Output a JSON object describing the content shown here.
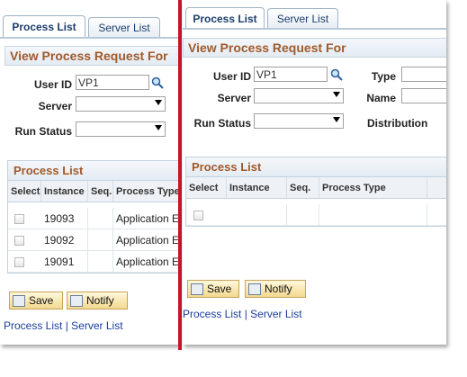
{
  "tabs": [
    {
      "label": "Process List",
      "underline": "P",
      "rest": "rocess List"
    },
    {
      "label": "Server List",
      "underline": "S",
      "rest": "erver List"
    }
  ],
  "section_title": "View Process Request For",
  "form": {
    "user_id_label": "User ID",
    "user_id_value": "VP1",
    "server_label": "Server",
    "run_status_label": "Run Status",
    "type_label": "Type",
    "name_label": "Name",
    "distribution_label": "Distribution"
  },
  "grid": {
    "title": "Process List",
    "columns": [
      "Select",
      "Instance",
      "Seq.",
      "Process Type"
    ],
    "rows": [
      {
        "instance": "19093",
        "seq": "",
        "type": "Application E"
      },
      {
        "instance": "19092",
        "seq": "",
        "type": "Application E"
      },
      {
        "instance": "19091",
        "seq": "",
        "type": "Application E"
      }
    ]
  },
  "buttons": {
    "save": "Save",
    "notify": "Notify"
  },
  "links": {
    "process_list": "Process List",
    "separator": "|",
    "server_list": "Server List"
  },
  "colors": {
    "divider": "#c8142a",
    "section_text": "#a15a2a",
    "link": "#1b3e9b"
  }
}
